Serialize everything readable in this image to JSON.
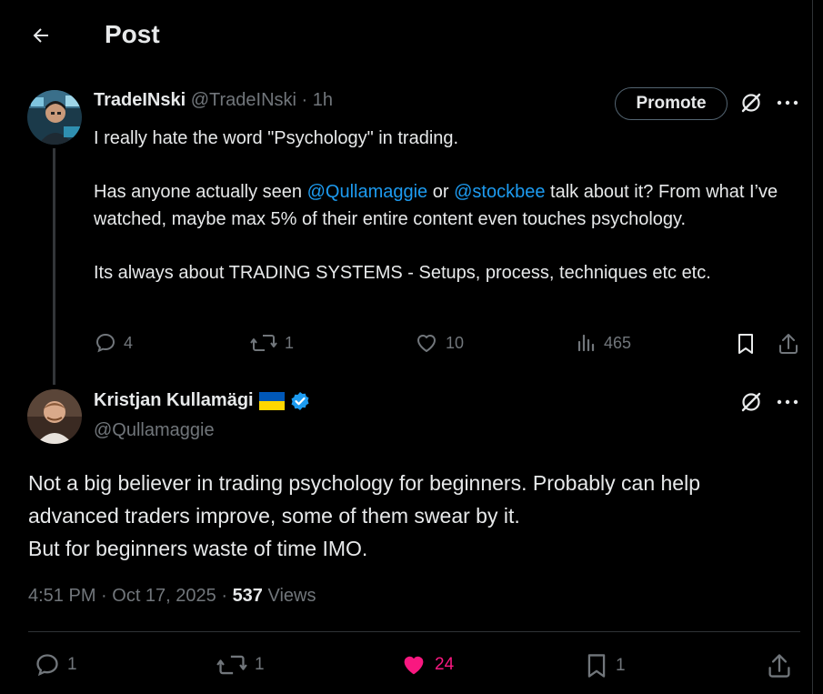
{
  "header": {
    "title": "Post"
  },
  "parent": {
    "name": "TradeINski",
    "handle": "@TradeINski",
    "sep": " · ",
    "time": "1h",
    "promote_label": "Promote",
    "text": {
      "l1": "I really hate the word \"Psychology\" in trading.",
      "l2a": "Has anyone actually seen ",
      "mention1": "@Qullamaggie",
      "l2b": " or ",
      "mention2": "@stockbee",
      "l2c": " talk about it? From what I’ve watched, maybe max 5% of their entire content even touches psychology.",
      "l3": "Its always about TRADING SYSTEMS - Setups, process, techniques etc etc."
    },
    "actions": {
      "replies": "4",
      "reposts": "1",
      "likes": "10",
      "views": "465"
    }
  },
  "reply": {
    "name": "Kristjan Kullamägi",
    "handle": "@Qullamaggie",
    "flag_colors": [
      "#0057b7",
      "#ffd700"
    ],
    "verified_color": "#1d9bf0",
    "lines": [
      "Not a big believer in trading psychology for beginners. Probably can help",
      "advanced traders improve, some of them swear by it.",
      "But for beginners waste of time IMO."
    ],
    "timestamp": "4:51 PM · Oct 17, 2025 · ",
    "views_count": "537",
    "views_label": " Views",
    "actions": {
      "replies": "1",
      "reposts": "1",
      "likes": "24",
      "bookmarks": "1"
    },
    "like_color": "#f91880"
  },
  "icons": [
    "back-arrow-icon",
    "grok-icon",
    "more-icon",
    "reply-icon",
    "repost-icon",
    "like-icon",
    "views-icon",
    "bookmark-icon",
    "share-icon",
    "verified-icon"
  ]
}
